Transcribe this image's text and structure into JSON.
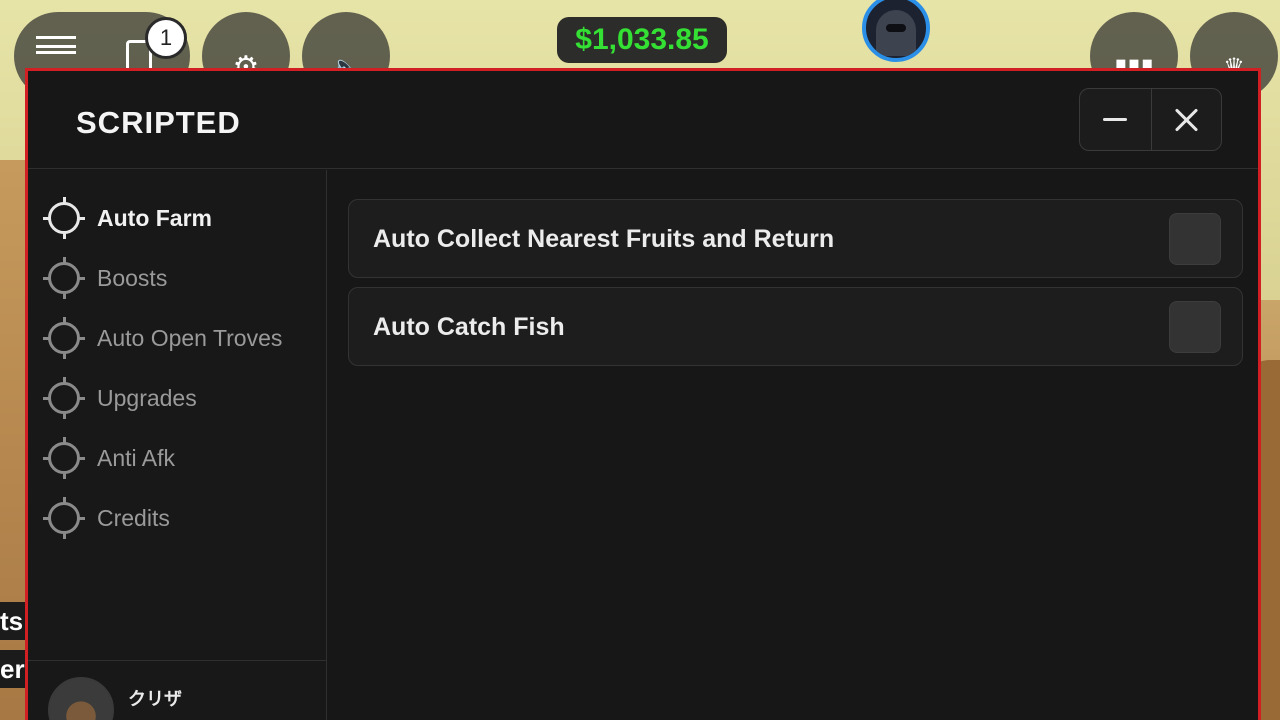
{
  "hud": {
    "notification_count": "1",
    "money": "$1,033.85"
  },
  "window": {
    "title": "SCRIPTED"
  },
  "sidebar": {
    "items": [
      {
        "label": "Auto Farm",
        "active": true
      },
      {
        "label": "Boosts",
        "active": false
      },
      {
        "label": "Auto Open Troves",
        "active": false
      },
      {
        "label": "Upgrades",
        "active": false
      },
      {
        "label": "Anti Afk",
        "active": false
      },
      {
        "label": "Credits",
        "active": false
      }
    ],
    "user": {
      "name": "クリザ"
    }
  },
  "content": {
    "toggles": [
      {
        "label": "Auto Collect Nearest Fruits and Return",
        "checked": false
      },
      {
        "label": "Auto Catch Fish",
        "checked": false
      }
    ]
  },
  "background": {
    "text_1": "ts",
    "text_2": "er"
  },
  "colors": {
    "window_border": "#d11f24",
    "money_text": "#35e034",
    "panel_bg": "#171717",
    "avatar_ring": "#2b8fe8"
  }
}
